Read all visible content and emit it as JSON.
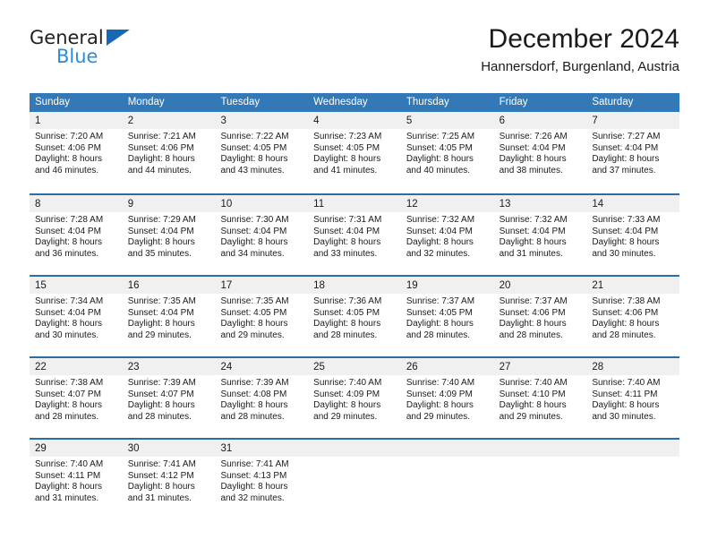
{
  "brand": {
    "name_part1": "General",
    "name_part2": "Blue",
    "accent_color": "#2b8ddb",
    "logo_triangle_color": "#1668b3"
  },
  "header": {
    "title": "December 2024",
    "subtitle": "Hannersdorf, Burgenland, Austria"
  },
  "theme": {
    "header_row_bg": "#3479b7",
    "week_divider": "#2e6da4",
    "daynum_band_bg": "#f0f0f0"
  },
  "weekdays": [
    "Sunday",
    "Monday",
    "Tuesday",
    "Wednesday",
    "Thursday",
    "Friday",
    "Saturday"
  ],
  "weeks": [
    [
      {
        "day": "1",
        "sunrise": "Sunrise: 7:20 AM",
        "sunset": "Sunset: 4:06 PM",
        "daylight1": "Daylight: 8 hours",
        "daylight2": "and 46 minutes."
      },
      {
        "day": "2",
        "sunrise": "Sunrise: 7:21 AM",
        "sunset": "Sunset: 4:06 PM",
        "daylight1": "Daylight: 8 hours",
        "daylight2": "and 44 minutes."
      },
      {
        "day": "3",
        "sunrise": "Sunrise: 7:22 AM",
        "sunset": "Sunset: 4:05 PM",
        "daylight1": "Daylight: 8 hours",
        "daylight2": "and 43 minutes."
      },
      {
        "day": "4",
        "sunrise": "Sunrise: 7:23 AM",
        "sunset": "Sunset: 4:05 PM",
        "daylight1": "Daylight: 8 hours",
        "daylight2": "and 41 minutes."
      },
      {
        "day": "5",
        "sunrise": "Sunrise: 7:25 AM",
        "sunset": "Sunset: 4:05 PM",
        "daylight1": "Daylight: 8 hours",
        "daylight2": "and 40 minutes."
      },
      {
        "day": "6",
        "sunrise": "Sunrise: 7:26 AM",
        "sunset": "Sunset: 4:04 PM",
        "daylight1": "Daylight: 8 hours",
        "daylight2": "and 38 minutes."
      },
      {
        "day": "7",
        "sunrise": "Sunrise: 7:27 AM",
        "sunset": "Sunset: 4:04 PM",
        "daylight1": "Daylight: 8 hours",
        "daylight2": "and 37 minutes."
      }
    ],
    [
      {
        "day": "8",
        "sunrise": "Sunrise: 7:28 AM",
        "sunset": "Sunset: 4:04 PM",
        "daylight1": "Daylight: 8 hours",
        "daylight2": "and 36 minutes."
      },
      {
        "day": "9",
        "sunrise": "Sunrise: 7:29 AM",
        "sunset": "Sunset: 4:04 PM",
        "daylight1": "Daylight: 8 hours",
        "daylight2": "and 35 minutes."
      },
      {
        "day": "10",
        "sunrise": "Sunrise: 7:30 AM",
        "sunset": "Sunset: 4:04 PM",
        "daylight1": "Daylight: 8 hours",
        "daylight2": "and 34 minutes."
      },
      {
        "day": "11",
        "sunrise": "Sunrise: 7:31 AM",
        "sunset": "Sunset: 4:04 PM",
        "daylight1": "Daylight: 8 hours",
        "daylight2": "and 33 minutes."
      },
      {
        "day": "12",
        "sunrise": "Sunrise: 7:32 AM",
        "sunset": "Sunset: 4:04 PM",
        "daylight1": "Daylight: 8 hours",
        "daylight2": "and 32 minutes."
      },
      {
        "day": "13",
        "sunrise": "Sunrise: 7:32 AM",
        "sunset": "Sunset: 4:04 PM",
        "daylight1": "Daylight: 8 hours",
        "daylight2": "and 31 minutes."
      },
      {
        "day": "14",
        "sunrise": "Sunrise: 7:33 AM",
        "sunset": "Sunset: 4:04 PM",
        "daylight1": "Daylight: 8 hours",
        "daylight2": "and 30 minutes."
      }
    ],
    [
      {
        "day": "15",
        "sunrise": "Sunrise: 7:34 AM",
        "sunset": "Sunset: 4:04 PM",
        "daylight1": "Daylight: 8 hours",
        "daylight2": "and 30 minutes."
      },
      {
        "day": "16",
        "sunrise": "Sunrise: 7:35 AM",
        "sunset": "Sunset: 4:04 PM",
        "daylight1": "Daylight: 8 hours",
        "daylight2": "and 29 minutes."
      },
      {
        "day": "17",
        "sunrise": "Sunrise: 7:35 AM",
        "sunset": "Sunset: 4:05 PM",
        "daylight1": "Daylight: 8 hours",
        "daylight2": "and 29 minutes."
      },
      {
        "day": "18",
        "sunrise": "Sunrise: 7:36 AM",
        "sunset": "Sunset: 4:05 PM",
        "daylight1": "Daylight: 8 hours",
        "daylight2": "and 28 minutes."
      },
      {
        "day": "19",
        "sunrise": "Sunrise: 7:37 AM",
        "sunset": "Sunset: 4:05 PM",
        "daylight1": "Daylight: 8 hours",
        "daylight2": "and 28 minutes."
      },
      {
        "day": "20",
        "sunrise": "Sunrise: 7:37 AM",
        "sunset": "Sunset: 4:06 PM",
        "daylight1": "Daylight: 8 hours",
        "daylight2": "and 28 minutes."
      },
      {
        "day": "21",
        "sunrise": "Sunrise: 7:38 AM",
        "sunset": "Sunset: 4:06 PM",
        "daylight1": "Daylight: 8 hours",
        "daylight2": "and 28 minutes."
      }
    ],
    [
      {
        "day": "22",
        "sunrise": "Sunrise: 7:38 AM",
        "sunset": "Sunset: 4:07 PM",
        "daylight1": "Daylight: 8 hours",
        "daylight2": "and 28 minutes."
      },
      {
        "day": "23",
        "sunrise": "Sunrise: 7:39 AM",
        "sunset": "Sunset: 4:07 PM",
        "daylight1": "Daylight: 8 hours",
        "daylight2": "and 28 minutes."
      },
      {
        "day": "24",
        "sunrise": "Sunrise: 7:39 AM",
        "sunset": "Sunset: 4:08 PM",
        "daylight1": "Daylight: 8 hours",
        "daylight2": "and 28 minutes."
      },
      {
        "day": "25",
        "sunrise": "Sunrise: 7:40 AM",
        "sunset": "Sunset: 4:09 PM",
        "daylight1": "Daylight: 8 hours",
        "daylight2": "and 29 minutes."
      },
      {
        "day": "26",
        "sunrise": "Sunrise: 7:40 AM",
        "sunset": "Sunset: 4:09 PM",
        "daylight1": "Daylight: 8 hours",
        "daylight2": "and 29 minutes."
      },
      {
        "day": "27",
        "sunrise": "Sunrise: 7:40 AM",
        "sunset": "Sunset: 4:10 PM",
        "daylight1": "Daylight: 8 hours",
        "daylight2": "and 29 minutes."
      },
      {
        "day": "28",
        "sunrise": "Sunrise: 7:40 AM",
        "sunset": "Sunset: 4:11 PM",
        "daylight1": "Daylight: 8 hours",
        "daylight2": "and 30 minutes."
      }
    ],
    [
      {
        "day": "29",
        "sunrise": "Sunrise: 7:40 AM",
        "sunset": "Sunset: 4:11 PM",
        "daylight1": "Daylight: 8 hours",
        "daylight2": "and 31 minutes."
      },
      {
        "day": "30",
        "sunrise": "Sunrise: 7:41 AM",
        "sunset": "Sunset: 4:12 PM",
        "daylight1": "Daylight: 8 hours",
        "daylight2": "and 31 minutes."
      },
      {
        "day": "31",
        "sunrise": "Sunrise: 7:41 AM",
        "sunset": "Sunset: 4:13 PM",
        "daylight1": "Daylight: 8 hours",
        "daylight2": "and 32 minutes."
      },
      {
        "day": "",
        "sunrise": "",
        "sunset": "",
        "daylight1": "",
        "daylight2": ""
      },
      {
        "day": "",
        "sunrise": "",
        "sunset": "",
        "daylight1": "",
        "daylight2": ""
      },
      {
        "day": "",
        "sunrise": "",
        "sunset": "",
        "daylight1": "",
        "daylight2": ""
      },
      {
        "day": "",
        "sunrise": "",
        "sunset": "",
        "daylight1": "",
        "daylight2": ""
      }
    ]
  ]
}
